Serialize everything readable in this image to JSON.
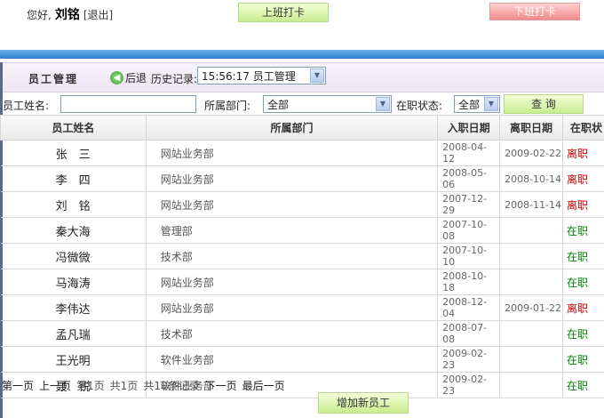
{
  "header": {
    "greeting": "您好,",
    "user_name": "刘铭",
    "logout": "[退出]",
    "clock_in": "上班打卡",
    "clock_out": "下班打卡"
  },
  "titlebar": {
    "title": "员工管理",
    "back": "后退",
    "history_label": "历史记录:",
    "history_value": "15:56:17 员工管理"
  },
  "filter": {
    "name_label": "员工姓名:",
    "name_value": "",
    "dept_label": "所属部门:",
    "dept_value": "全部",
    "status_label": "在职状态:",
    "status_value": "全部",
    "search": "查 询"
  },
  "table": {
    "headers": [
      "员工姓名",
      "所属部门",
      "入职日期",
      "离职日期",
      "在职状"
    ],
    "rows": [
      {
        "name": "张　三",
        "dept": "网站业务部",
        "join": "2008-04-12",
        "leave": "2009-02-22",
        "status": "离职",
        "color": "#cc0000"
      },
      {
        "name": "李　四",
        "dept": "网站业务部",
        "join": "2008-05-06",
        "leave": "2008-10-14",
        "status": "离职",
        "color": "#cc0000"
      },
      {
        "name": "刘　铭",
        "dept": "网站业务部",
        "join": "2007-12-29",
        "leave": "2008-11-14",
        "status": "离职",
        "color": "#cc0000"
      },
      {
        "name": "秦大海",
        "dept": "管理部",
        "join": "2007-10-08",
        "leave": "",
        "status": "在职",
        "color": "#008000"
      },
      {
        "name": "冯微微",
        "dept": "技术部",
        "join": "2007-10-10",
        "leave": "",
        "status": "在职",
        "color": "#008000"
      },
      {
        "name": "马海涛",
        "dept": "网站业务部",
        "join": "2008-10-18",
        "leave": "",
        "status": "在职",
        "color": "#008000"
      },
      {
        "name": "李伟达",
        "dept": "网站业务部",
        "join": "2008-12-04",
        "leave": "2009-01-22",
        "status": "离职",
        "color": "#cc0000"
      },
      {
        "name": "孟凡瑞",
        "dept": "技术部",
        "join": "2008-07-08",
        "leave": "",
        "status": "在职",
        "color": "#008000"
      },
      {
        "name": "王光明",
        "dept": "软件业务部",
        "join": "2009-02-23",
        "leave": "",
        "status": "在职",
        "color": "#008000"
      },
      {
        "name": "聂　锐",
        "dept": "软件业务部",
        "join": "2009-02-23",
        "leave": "",
        "status": "在职",
        "color": "#008000"
      }
    ]
  },
  "pager": {
    "first": "第一页",
    "prev": "上一页",
    "current": "第1页",
    "total_pages": "共1页",
    "total_records": "共10条记录",
    "next": "下一页",
    "last": "最后一页"
  },
  "add_button": "增加新员工"
}
